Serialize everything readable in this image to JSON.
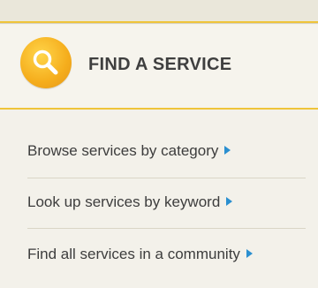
{
  "header": {
    "title": "FIND A SERVICE",
    "icon": "magnifier-icon",
    "accent_color": "#f5ad1c"
  },
  "links": [
    {
      "label": "Browse services by category"
    },
    {
      "label": "Look up services by keyword"
    },
    {
      "label": "Find all services in a community"
    }
  ],
  "colors": {
    "arrow": "#2a8fd0",
    "rule": "#efc43a",
    "text": "#3d3d3d"
  }
}
